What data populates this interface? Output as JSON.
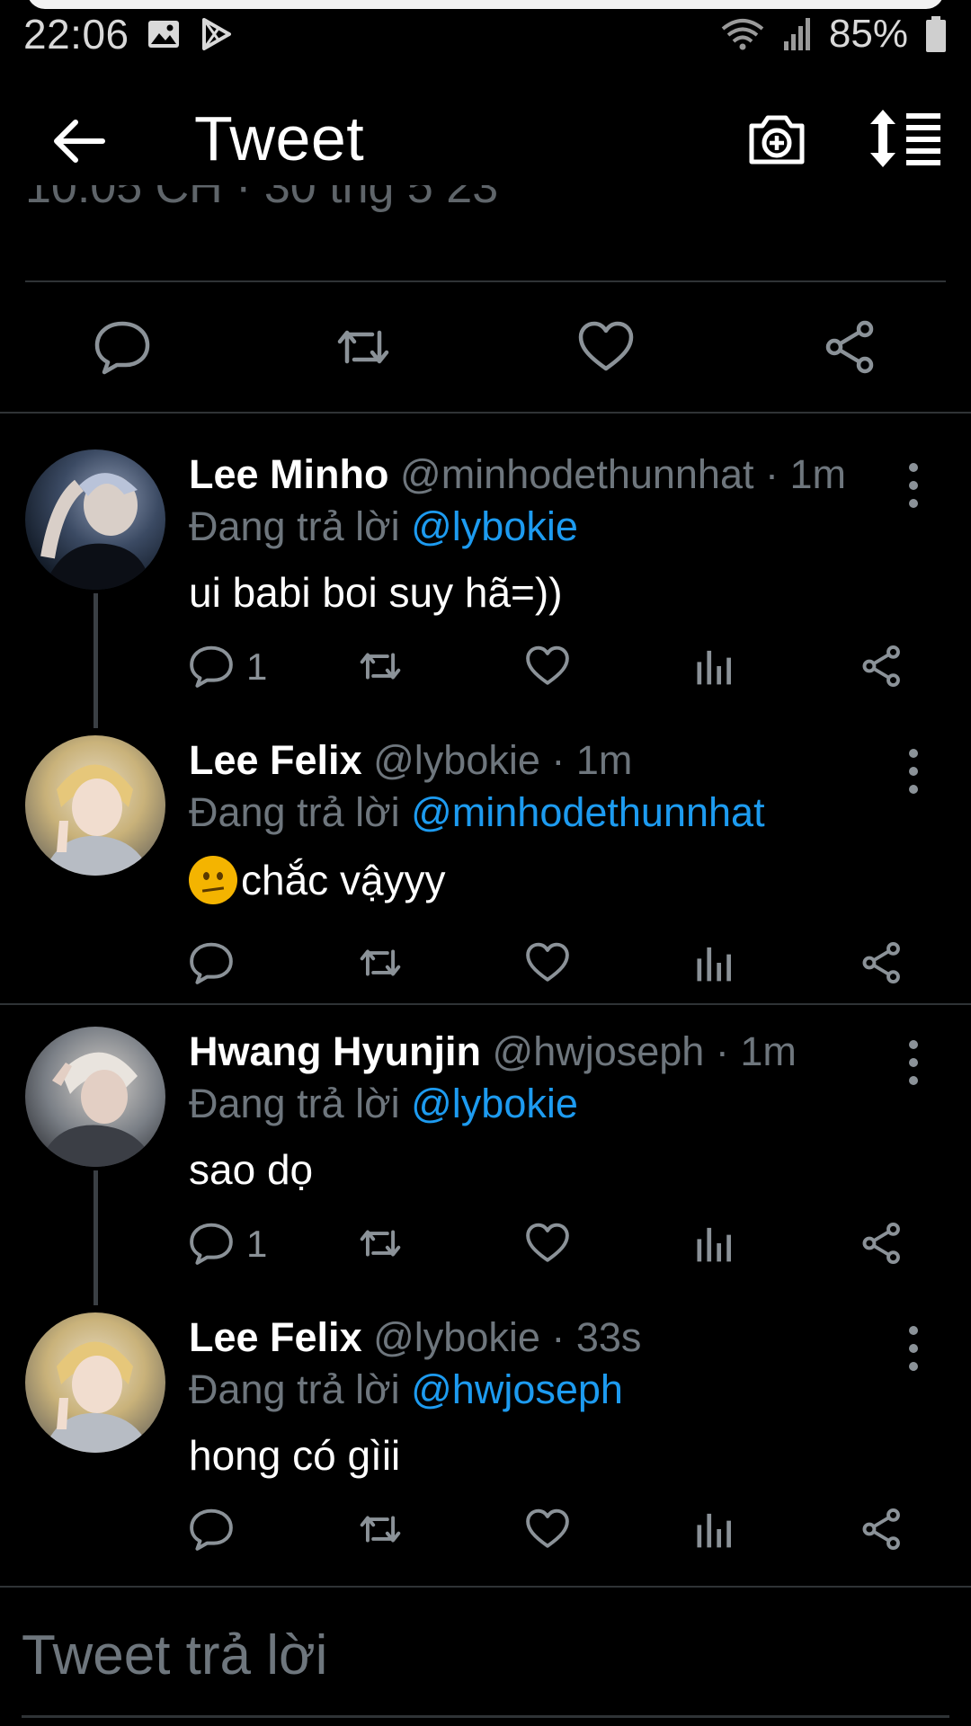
{
  "status_bar": {
    "time": "22:06",
    "battery": "85%",
    "icons": [
      "gallery-icon",
      "play-store-icon",
      "wifi-icon",
      "signal-icon",
      "battery-icon"
    ]
  },
  "header": {
    "title": "Tweet",
    "icons": [
      "back-arrow-icon",
      "camera-add-icon",
      "sort-icon"
    ]
  },
  "partial_text": "10:05 CH · 30 thg 5 23",
  "main_actions": [
    "reply-icon",
    "retweet-icon",
    "like-icon",
    "share-icon"
  ],
  "replies": [
    {
      "name": "Lee Minho",
      "handle": "@minhodethunnhat",
      "time": "· 1m",
      "replying_prefix": "Đang trả lời ",
      "replying_to": "@lybokie",
      "text": "ui babi boi suy hã=))",
      "reply_count": "1",
      "avatar_colors": [
        "#1b2a3c",
        "#8f9bb3"
      ]
    },
    {
      "name": "Lee Felix",
      "handle": "@lybokie",
      "time": "· 1m",
      "replying_prefix": "Đang trả lời ",
      "replying_to": "@minhodethunnhat",
      "text": "chắc vậyyy",
      "reply_count": "",
      "avatar_colors": [
        "#c9b27a",
        "#e8dcc4"
      ]
    },
    {
      "name": "Hwang Hyunjin",
      "handle": "@hwjoseph",
      "time": "· 1m",
      "replying_prefix": "Đang trả lời ",
      "replying_to": "@lybokie",
      "text": "sao dọ",
      "reply_count": "1",
      "avatar_colors": [
        "#7a7f86",
        "#d7d2cc"
      ]
    },
    {
      "name": "Lee Felix",
      "handle": "@lybokie",
      "time": "· 33s",
      "replying_prefix": "Đang trả lời ",
      "replying_to": "@hwjoseph",
      "text": "hong có gìii",
      "reply_count": "",
      "avatar_colors": [
        "#c9b27a",
        "#e8dcc4"
      ]
    }
  ],
  "composer": {
    "placeholder": "Tweet trả lời"
  },
  "colors": {
    "background": "#000000",
    "mention": "#1d9bf0",
    "secondary_text": "#6e767d",
    "divider": "#2f3336"
  }
}
